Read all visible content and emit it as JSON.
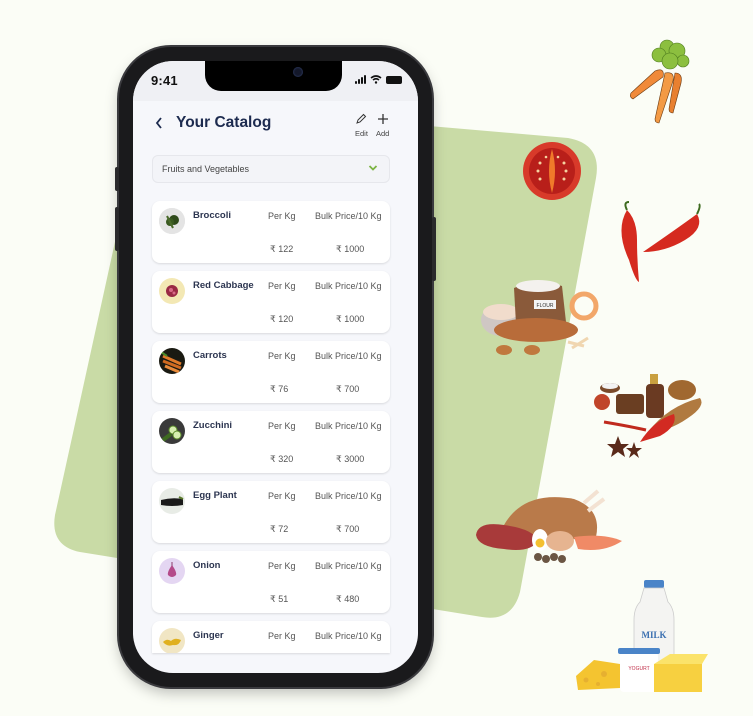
{
  "status_bar": {
    "time": "9:41"
  },
  "header": {
    "back_icon": "chevron-left-icon",
    "title": "Your Catalog",
    "edit_label": "Edit",
    "add_label": "Add"
  },
  "category_select": {
    "selected": "Fruits and Vegetables"
  },
  "products": [
    {
      "name": "Broccoli",
      "per_label": "Per Kg",
      "bulk_label": "Bulk Price/10 Kg",
      "per_price": "₹ 122",
      "bulk_price": "₹ 1000"
    },
    {
      "name": "Red Cabbage",
      "per_label": "Per Kg",
      "bulk_label": "Bulk Price/10 Kg",
      "per_price": "₹ 120",
      "bulk_price": "₹ 1000"
    },
    {
      "name": "Carrots",
      "per_label": "Per Kg",
      "bulk_label": "Bulk Price/10 Kg",
      "per_price": "₹ 76",
      "bulk_price": "₹ 700"
    },
    {
      "name": "Zucchini",
      "per_label": "Per Kg",
      "bulk_label": "Bulk Price/10 Kg",
      "per_price": "₹  320",
      "bulk_price": "₹ 3000"
    },
    {
      "name": "Egg Plant",
      "per_label": "Per Kg",
      "bulk_label": "Bulk Price/10 Kg",
      "per_price": "₹ 72",
      "bulk_price": "₹ 700"
    },
    {
      "name": "Onion",
      "per_label": "Per Kg",
      "bulk_label": "Bulk Price/10 Kg",
      "per_price": "₹  51",
      "bulk_price": "₹ 480"
    },
    {
      "name": "Ginger",
      "per_label": "Per Kg",
      "bulk_label": "Bulk Price/10 Kg",
      "per_price": "",
      "bulk_price": ""
    }
  ],
  "decorations": {
    "flour_label": "FLOUR",
    "milk_label": "MILK",
    "yogurt_label": "YOGURT"
  },
  "colors": {
    "background": "#fbfdf6",
    "green_shape": "#c9dba6",
    "title": "#1d2b4f",
    "accent_green": "#7cb342"
  }
}
